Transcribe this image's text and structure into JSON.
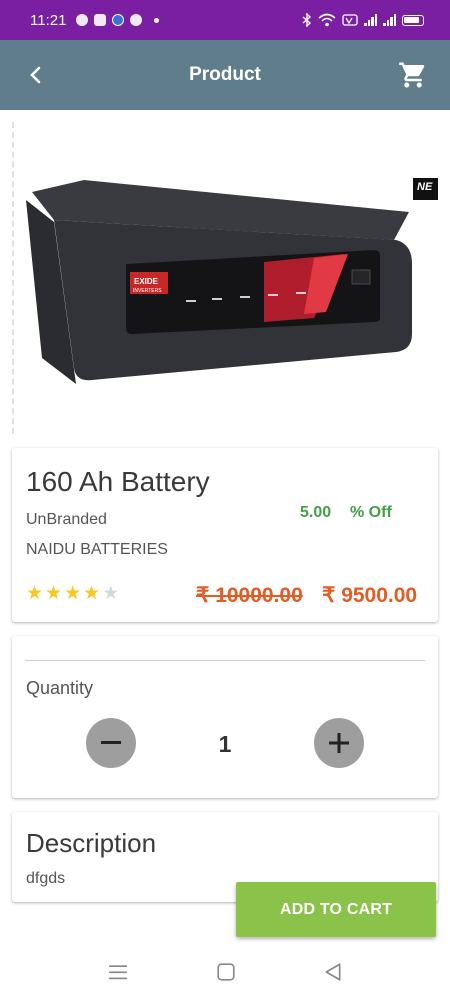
{
  "status_bar": {
    "time": "11:21",
    "left_icons": [
      "snapchat-icon",
      "sim-card-icon",
      "browser-icon",
      "minus-circle-icon",
      "dot-icon"
    ],
    "right_icons": [
      "bluetooth-icon",
      "wifi-icon",
      "volte-icon",
      "signal-icon",
      "signal-icon",
      "battery-icon"
    ],
    "color": "#7b1fa2"
  },
  "app_bar": {
    "title": "Product",
    "back_icon": "chevron-left-icon",
    "cart_icon": "shopping-cart-icon",
    "color": "#607d8b"
  },
  "product_image": {
    "brand_text": "EXIDE",
    "sub_text": "INVERTERS",
    "next_thumb_text": "NE"
  },
  "product": {
    "name": "160 Ah Battery",
    "brand": "UnBranded",
    "seller": "NAIDU BATTERIES",
    "discount": "5.00",
    "discount_label": "% Off",
    "rating": 4,
    "rating_max": 5,
    "old_price": "₹ 10000.00",
    "new_price": "₹ 9500.00",
    "price_color": "#e25c24",
    "discount_color": "#43a047"
  },
  "quantity": {
    "label": "Quantity",
    "value": "1"
  },
  "description": {
    "title": "Description",
    "text": "dfgds"
  },
  "actions": {
    "add_to_cart": "ADD TO CART",
    "button_color": "#8bc34a"
  },
  "nav_bar": {
    "icons": [
      "menu-icon",
      "home-square-icon",
      "back-triangle-icon"
    ]
  }
}
